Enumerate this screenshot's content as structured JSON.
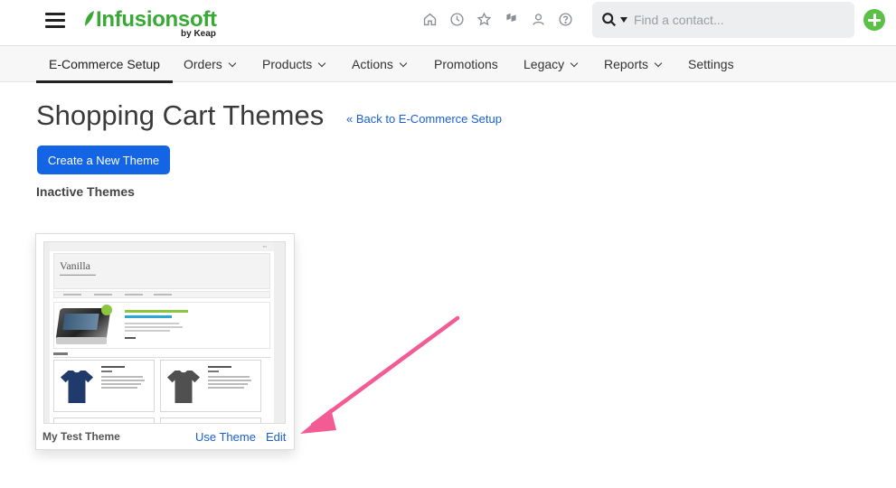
{
  "header": {
    "logo_text": "Infusionsoft",
    "logo_sub": "by Keap",
    "icons": [
      "home-icon",
      "clock-icon",
      "star-icon",
      "flag-icon",
      "user-icon",
      "help-icon"
    ],
    "search": {
      "placeholder": "Find a contact..."
    },
    "brand_color": "#39a935"
  },
  "nav": {
    "items": [
      {
        "label": "E-Commerce Setup",
        "dropdown": false,
        "active": true
      },
      {
        "label": "Orders",
        "dropdown": true
      },
      {
        "label": "Products",
        "dropdown": true
      },
      {
        "label": "Actions",
        "dropdown": true
      },
      {
        "label": "Promotions",
        "dropdown": false
      },
      {
        "label": "Legacy",
        "dropdown": true
      },
      {
        "label": "Reports",
        "dropdown": true
      },
      {
        "label": "Settings",
        "dropdown": false
      }
    ]
  },
  "main": {
    "title": "Shopping Cart Themes",
    "back_link": "« Back to E-Commerce Setup",
    "create_button": "Create a New Theme",
    "section_title": "Inactive Themes",
    "link_color": "#1a5fd6",
    "button_color": "#1464e6"
  },
  "theme_card": {
    "name": "My Test Theme",
    "use_label": "Use Theme",
    "edit_label": "Edit",
    "preview": {
      "title": "Vanilla"
    }
  },
  "annotation": {
    "arrow_color": "#f25b94"
  }
}
